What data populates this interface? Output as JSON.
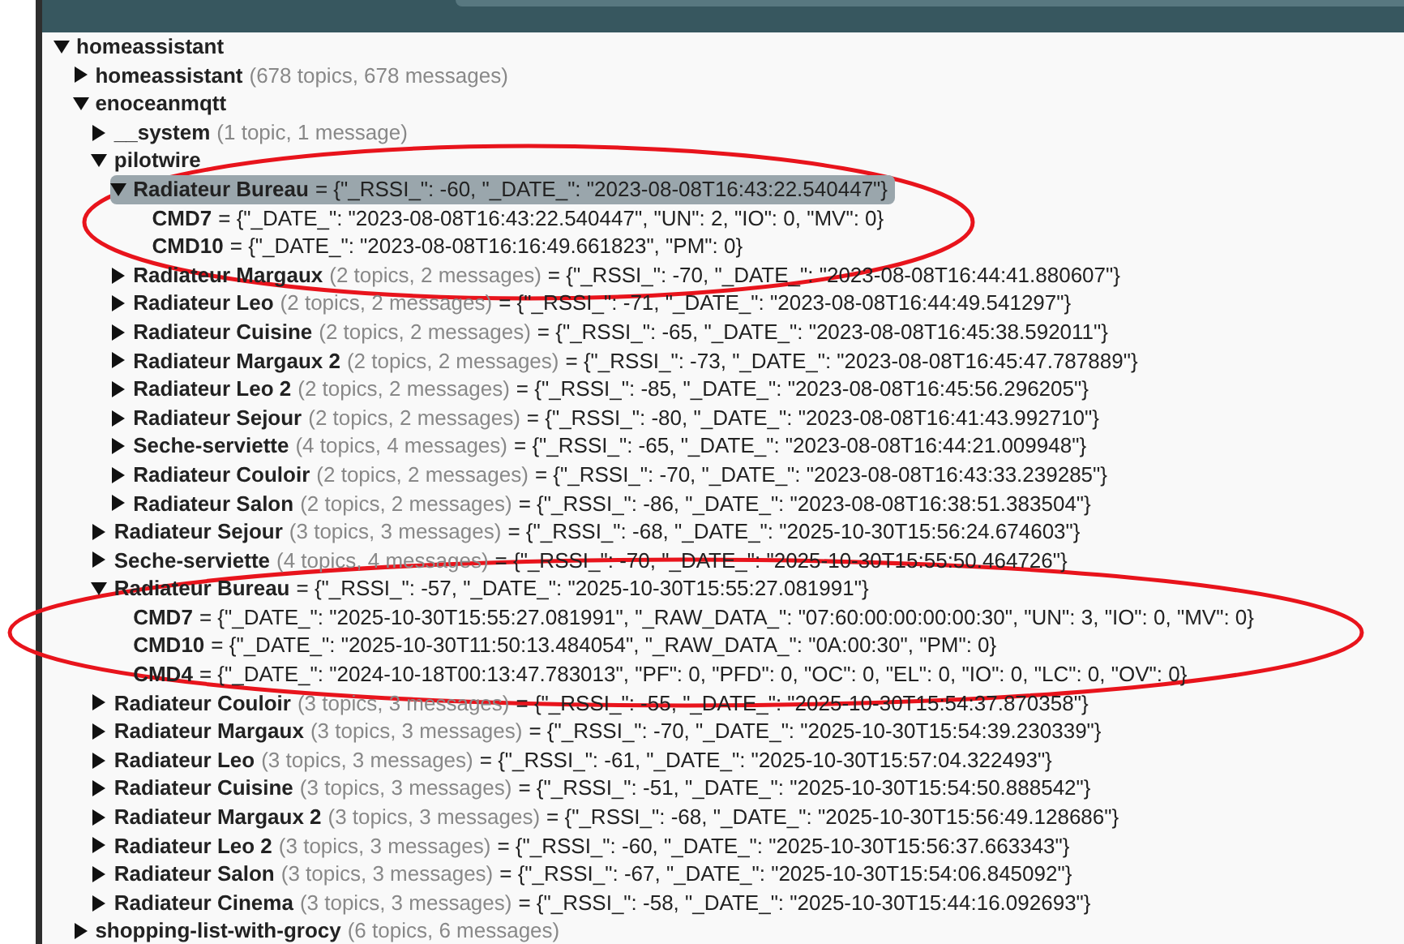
{
  "search": {
    "kind": "field"
  },
  "tree": [
    {
      "kind": "folder",
      "name": "homeassistant",
      "expanded": true,
      "selected": false,
      "children": [
        {
          "kind": "folder",
          "name": "homeassistant",
          "summary": "(678 topics, 678 messages)",
          "expanded": false,
          "selected": false
        },
        {
          "kind": "folder",
          "name": "enoceanmqtt",
          "expanded": true,
          "selected": false,
          "children": [
            {
              "kind": "folder",
              "name": "__system",
              "summary": "(1 topic, 1 message)",
              "expanded": false,
              "selected": false
            },
            {
              "kind": "folder",
              "name": "pilotwire",
              "expanded": true,
              "selected": false,
              "children": [
                {
                  "kind": "folder",
                  "name": "Radiateur Bureau",
                  "value": "= {\"_RSSI_\": -60, \"_DATE_\": \"2023-08-08T16:43:22.540447\"}",
                  "expanded": true,
                  "selected": true,
                  "children": [
                    {
                      "kind": "leaf",
                      "name": "CMD7",
                      "value": "= {\"_DATE_\": \"2023-08-08T16:43:22.540447\", \"UN\": 2, \"IO\": 0, \"MV\": 0}",
                      "selected": false
                    },
                    {
                      "kind": "leaf",
                      "name": "CMD10",
                      "value": "= {\"_DATE_\": \"2023-08-08T16:16:49.661823\", \"PM\": 0}",
                      "selected": false
                    }
                  ]
                },
                {
                  "kind": "folder",
                  "name": "Radiateur Margaux",
                  "summary": "(2 topics, 2 messages)",
                  "value": "= {\"_RSSI_\": -70, \"_DATE_\": \"2023-08-08T16:44:41.880607\"}",
                  "expanded": false,
                  "selected": false
                },
                {
                  "kind": "folder",
                  "name": "Radiateur Leo",
                  "summary": "(2 topics, 2 messages)",
                  "value": "= {\"_RSSI_\": -71, \"_DATE_\": \"2023-08-08T16:44:49.541297\"}",
                  "expanded": false,
                  "selected": false
                },
                {
                  "kind": "folder",
                  "name": "Radiateur Cuisine",
                  "summary": "(2 topics, 2 messages)",
                  "value": "= {\"_RSSI_\": -65, \"_DATE_\": \"2023-08-08T16:45:38.592011\"}",
                  "expanded": false,
                  "selected": false
                },
                {
                  "kind": "folder",
                  "name": "Radiateur Margaux 2",
                  "summary": "(2 topics, 2 messages)",
                  "value": "= {\"_RSSI_\": -73, \"_DATE_\": \"2023-08-08T16:45:47.787889\"}",
                  "expanded": false,
                  "selected": false
                },
                {
                  "kind": "folder",
                  "name": "Radiateur Leo 2",
                  "summary": "(2 topics, 2 messages)",
                  "value": "= {\"_RSSI_\": -85, \"_DATE_\": \"2023-08-08T16:45:56.296205\"}",
                  "expanded": false,
                  "selected": false
                },
                {
                  "kind": "folder",
                  "name": "Radiateur Sejour",
                  "summary": "(2 topics, 2 messages)",
                  "value": "= {\"_RSSI_\": -80, \"_DATE_\": \"2023-08-08T16:41:43.992710\"}",
                  "expanded": false,
                  "selected": false
                },
                {
                  "kind": "folder",
                  "name": "Seche-serviette",
                  "summary": "(4 topics, 4 messages)",
                  "value": "= {\"_RSSI_\": -65, \"_DATE_\": \"2023-08-08T16:44:21.009948\"}",
                  "expanded": false,
                  "selected": false
                },
                {
                  "kind": "folder",
                  "name": "Radiateur Couloir",
                  "summary": "(2 topics, 2 messages)",
                  "value": "= {\"_RSSI_\": -70, \"_DATE_\": \"2023-08-08T16:43:33.239285\"}",
                  "expanded": false,
                  "selected": false
                },
                {
                  "kind": "folder",
                  "name": "Radiateur Salon",
                  "summary": "(2 topics, 2 messages)",
                  "value": "= {\"_RSSI_\": -86, \"_DATE_\": \"2023-08-08T16:38:51.383504\"}",
                  "expanded": false,
                  "selected": false
                }
              ]
            },
            {
              "kind": "folder",
              "name": "Radiateur Sejour",
              "summary": "(3 topics, 3 messages)",
              "value": "= {\"_RSSI_\": -68, \"_DATE_\": \"2025-10-30T15:56:24.674603\"}",
              "expanded": false,
              "selected": false
            },
            {
              "kind": "folder",
              "name": "Seche-serviette",
              "summary": "(4 topics, 4 messages)",
              "value": "= {\"_RSSI_\": -70, \"_DATE_\": \"2025-10-30T15:55:50.464726\"}",
              "expanded": false,
              "selected": false
            },
            {
              "kind": "folder",
              "name": "Radiateur Bureau",
              "value": "= {\"_RSSI_\": -57, \"_DATE_\": \"2025-10-30T15:55:27.081991\"}",
              "expanded": true,
              "selected": false,
              "children": [
                {
                  "kind": "leaf",
                  "name": "CMD7",
                  "value": "= {\"_DATE_\": \"2025-10-30T15:55:27.081991\", \"_RAW_DATA_\": \"07:60:00:00:00:00:30\", \"UN\": 3, \"IO\": 0, \"MV\": 0}",
                  "selected": false
                },
                {
                  "kind": "leaf",
                  "name": "CMD10",
                  "value": "= {\"_DATE_\": \"2025-10-30T11:50:13.484054\", \"_RAW_DATA_\": \"0A:00:30\", \"PM\": 0}",
                  "selected": false
                },
                {
                  "kind": "leaf",
                  "name": "CMD4",
                  "value": "= {\"_DATE_\": \"2024-10-18T00:13:47.783013\", \"PF\": 0, \"PFD\": 0, \"OC\": 0, \"EL\": 0, \"IO\": 0, \"LC\": 0, \"OV\": 0}",
                  "selected": false
                }
              ]
            },
            {
              "kind": "folder",
              "name": "Radiateur Couloir",
              "summary": "(3 topics, 3 messages)",
              "value": "= {\"_RSSI_\": -55, \"_DATE_\": \"2025-10-30T15:54:37.870358\"}",
              "expanded": false,
              "selected": false
            },
            {
              "kind": "folder",
              "name": "Radiateur Margaux",
              "summary": "(3 topics, 3 messages)",
              "value": "= {\"_RSSI_\": -70, \"_DATE_\": \"2025-10-30T15:54:39.230339\"}",
              "expanded": false,
              "selected": false
            },
            {
              "kind": "folder",
              "name": "Radiateur Leo",
              "summary": "(3 topics, 3 messages)",
              "value": "= {\"_RSSI_\": -61, \"_DATE_\": \"2025-10-30T15:57:04.322493\"}",
              "expanded": false,
              "selected": false
            },
            {
              "kind": "folder",
              "name": "Radiateur Cuisine",
              "summary": "(3 topics, 3 messages)",
              "value": "= {\"_RSSI_\": -51, \"_DATE_\": \"2025-10-30T15:54:50.888542\"}",
              "expanded": false,
              "selected": false
            },
            {
              "kind": "folder",
              "name": "Radiateur Margaux 2",
              "summary": "(3 topics, 3 messages)",
              "value": "= {\"_RSSI_\": -68, \"_DATE_\": \"2025-10-30T15:56:49.128686\"}",
              "expanded": false,
              "selected": false
            },
            {
              "kind": "folder",
              "name": "Radiateur Leo 2",
              "summary": "(3 topics, 3 messages)",
              "value": "= {\"_RSSI_\": -60, \"_DATE_\": \"2025-10-30T15:56:37.663343\"}",
              "expanded": false,
              "selected": false
            },
            {
              "kind": "folder",
              "name": "Radiateur Salon",
              "summary": "(3 topics, 3 messages)",
              "value": "= {\"_RSSI_\": -67, \"_DATE_\": \"2025-10-30T15:54:06.845092\"}",
              "expanded": false,
              "selected": false
            },
            {
              "kind": "folder",
              "name": "Radiateur Cinema",
              "summary": "(3 topics, 3 messages)",
              "value": "= {\"_RSSI_\": -58, \"_DATE_\": \"2025-10-30T15:44:16.092693\"}",
              "expanded": false,
              "selected": false
            }
          ]
        },
        {
          "kind": "folder",
          "name": "shopping-list-with-grocy",
          "summary": "(6 topics, 6 messages)",
          "expanded": false,
          "selected": false
        }
      ]
    }
  ]
}
